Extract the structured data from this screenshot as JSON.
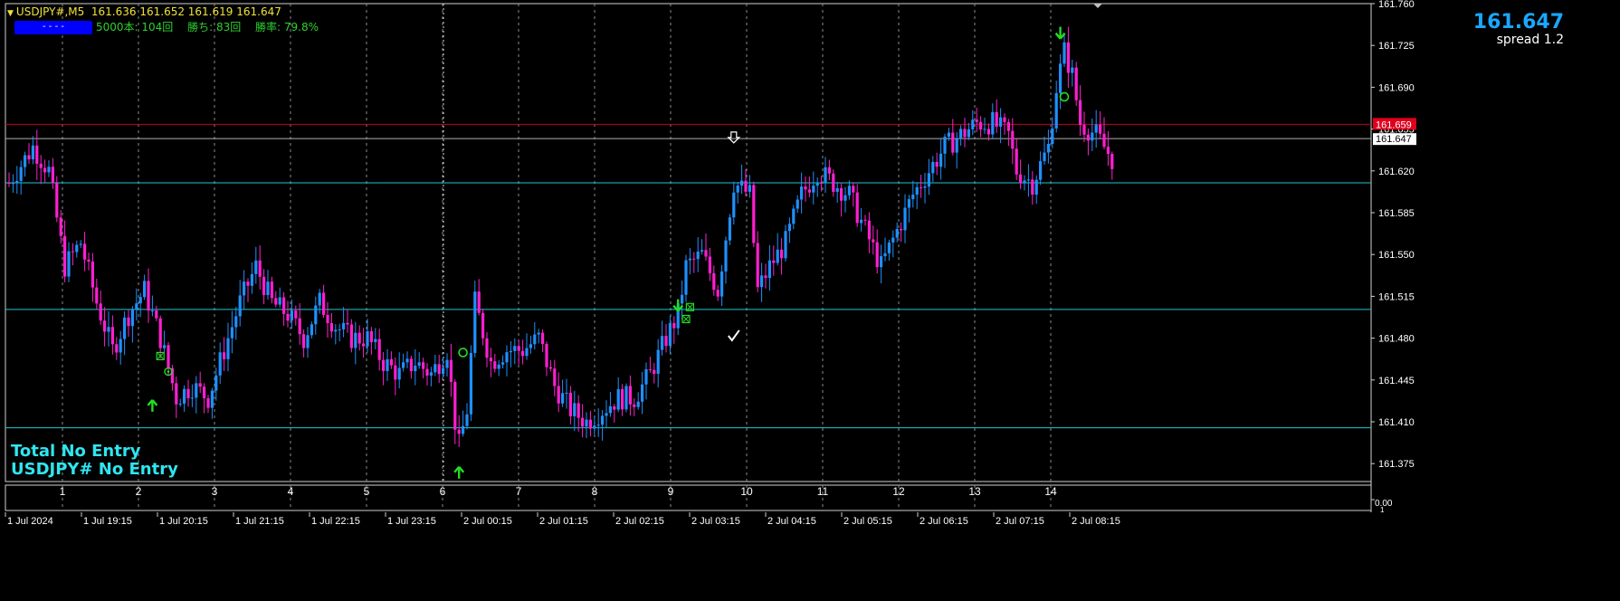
{
  "header": {
    "symbol": "USDJPY#,M5",
    "ohlc": "161.636 161.652 161.619 161.647",
    "blue_label": "- - - -",
    "stats": "5000本: 104回　 勝ち: 83回　 勝率: 79.8%"
  },
  "price_display": {
    "price": "161.647",
    "spread": "spread 1.2"
  },
  "status": {
    "line1": "Total No Entry",
    "line2": "USDJPY# No Entry"
  },
  "colors": {
    "bull": "#1e90ff",
    "bear": "#ff1fd0",
    "grid": "#8a8a8a",
    "hline": "#1fc8d0",
    "resist": "#c8001e",
    "signal": "#22dd22",
    "text": "#ffffff"
  },
  "chart_data": {
    "type": "candlestick",
    "y_ticks": [
      "161.760",
      "161.725",
      "161.690",
      "161.655",
      "161.620",
      "161.585",
      "161.550",
      "161.515",
      "161.480",
      "161.445",
      "161.410",
      "161.375"
    ],
    "ylim": [
      161.36,
      161.76
    ],
    "current_price_label": "161.647",
    "red_line_label": "161.659",
    "red_line": 161.659,
    "current_line": 161.647,
    "horizontal_levels": [
      161.61,
      161.504,
      161.405
    ],
    "day_ticks": [
      "1",
      "2",
      "3",
      "4",
      "5",
      "6",
      "7",
      "8",
      "9",
      "10",
      "11",
      "12",
      "13",
      "14"
    ],
    "time_ticks": [
      "1 Jul 2024",
      "1 Jul 19:15",
      "1 Jul 20:15",
      "1 Jul 21:15",
      "1 Jul 22:15",
      "1 Jul 23:15",
      "2 Jul 00:15",
      "2 Jul 01:15",
      "2 Jul 02:15",
      "2 Jul 03:15",
      "2 Jul 04:15",
      "2 Jul 05:15",
      "2 Jul 06:15",
      "2 Jul 07:15",
      "2 Jul 08:15"
    ],
    "macd_ticks": [
      "0.00",
      "1"
    ],
    "anchors": [
      [
        0,
        161.61
      ],
      [
        6,
        161.64
      ],
      [
        10,
        161.62
      ],
      [
        14,
        161.54
      ],
      [
        18,
        161.56
      ],
      [
        22,
        161.51
      ],
      [
        26,
        161.47
      ],
      [
        30,
        161.5
      ],
      [
        34,
        161.52
      ],
      [
        38,
        161.48
      ],
      [
        42,
        161.43
      ],
      [
        46,
        161.44
      ],
      [
        50,
        161.43
      ],
      [
        54,
        161.47
      ],
      [
        58,
        161.51
      ],
      [
        62,
        161.54
      ],
      [
        66,
        161.51
      ],
      [
        70,
        161.5
      ],
      [
        74,
        161.48
      ],
      [
        78,
        161.51
      ],
      [
        82,
        161.49
      ],
      [
        86,
        161.48
      ],
      [
        90,
        161.48
      ],
      [
        94,
        161.46
      ],
      [
        98,
        161.45
      ],
      [
        102,
        161.46
      ],
      [
        106,
        161.45
      ],
      [
        110,
        161.47
      ],
      [
        112,
        161.41
      ],
      [
        113,
        161.39
      ],
      [
        115,
        161.42
      ],
      [
        117,
        161.51
      ],
      [
        121,
        161.46
      ],
      [
        125,
        161.47
      ],
      [
        129,
        161.47
      ],
      [
        133,
        161.48
      ],
      [
        137,
        161.44
      ],
      [
        141,
        161.42
      ],
      [
        145,
        161.41
      ],
      [
        149,
        161.42
      ],
      [
        153,
        161.43
      ],
      [
        157,
        161.43
      ],
      [
        161,
        161.45
      ],
      [
        165,
        161.48
      ],
      [
        168,
        161.5
      ],
      [
        170,
        161.54
      ],
      [
        174,
        161.55
      ],
      [
        178,
        161.52
      ],
      [
        182,
        161.61
      ],
      [
        186,
        161.6
      ],
      [
        188,
        161.52
      ],
      [
        191,
        161.54
      ],
      [
        195,
        161.56
      ],
      [
        199,
        161.6
      ],
      [
        203,
        161.62
      ],
      [
        207,
        161.61
      ],
      [
        211,
        161.6
      ],
      [
        215,
        161.57
      ],
      [
        219,
        161.54
      ],
      [
        223,
        161.57
      ],
      [
        227,
        161.6
      ],
      [
        231,
        161.62
      ],
      [
        235,
        161.64
      ],
      [
        239,
        161.65
      ],
      [
        243,
        161.66
      ],
      [
        247,
        161.66
      ],
      [
        251,
        161.65
      ],
      [
        253,
        161.62
      ],
      [
        257,
        161.61
      ],
      [
        261,
        161.64
      ],
      [
        263,
        161.69
      ],
      [
        265,
        161.72
      ],
      [
        267,
        161.7
      ],
      [
        269,
        161.66
      ],
      [
        273,
        161.65
      ],
      [
        277,
        161.63
      ]
    ],
    "signals": [
      {
        "kind": "up-arrow",
        "i": 36,
        "price": 161.423
      },
      {
        "kind": "box",
        "i": 38,
        "price": 161.465
      },
      {
        "kind": "circle-dot",
        "i": 40,
        "price": 161.452
      },
      {
        "kind": "up-arrow",
        "i": 113,
        "price": 161.367
      },
      {
        "kind": "circle",
        "i": 114,
        "price": 161.468
      },
      {
        "kind": "down-arrow",
        "i": 168,
        "price": 161.508
      },
      {
        "kind": "box",
        "i": 170,
        "price": 161.496
      },
      {
        "kind": "box",
        "i": 171,
        "price": 161.506
      },
      {
        "kind": "down-arrow-white",
        "i": 182,
        "price": 161.648
      },
      {
        "kind": "check",
        "i": 182,
        "price": 161.482
      },
      {
        "kind": "down-arrow",
        "i": 264,
        "price": 161.736
      },
      {
        "kind": "circle",
        "i": 265,
        "price": 161.682
      }
    ]
  }
}
